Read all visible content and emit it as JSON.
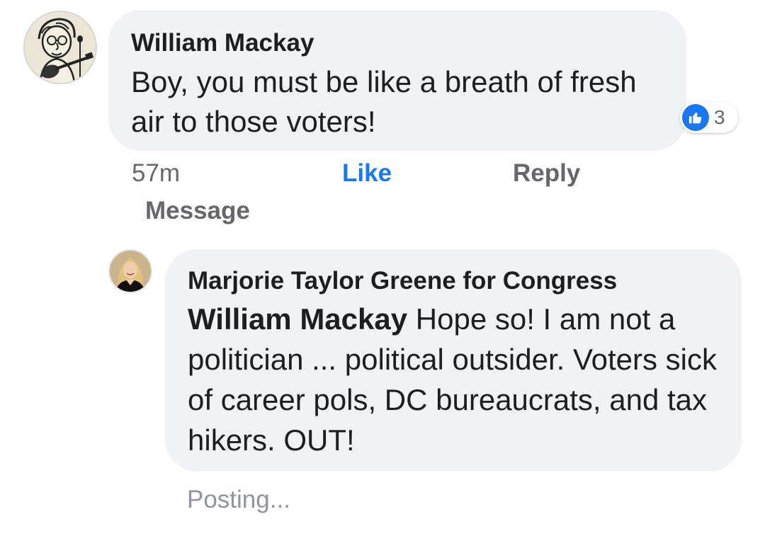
{
  "comments": [
    {
      "author": "William Mackay",
      "text": "Boy, you must be like a breath of fresh air to those voters!",
      "reactions": {
        "icon": "thumbs-up-icon",
        "count": "3",
        "color": "#1877f2"
      },
      "actions": {
        "time": "57m",
        "like": "Like",
        "reply": "Reply",
        "message": "Message"
      }
    }
  ],
  "reply": {
    "author": "Marjorie Taylor Greene for Congress",
    "mention": "William Mackay",
    "text": " Hope so! I am not a politician ... political outsider. Voters sick of career pols, DC bureaucrats, and tax hikers. OUT!",
    "status": "Posting..."
  },
  "colors": {
    "bubble": "#f0f2f5",
    "accent": "#1877f2",
    "secondary_text": "#65676b",
    "muted_text": "#90949c"
  }
}
